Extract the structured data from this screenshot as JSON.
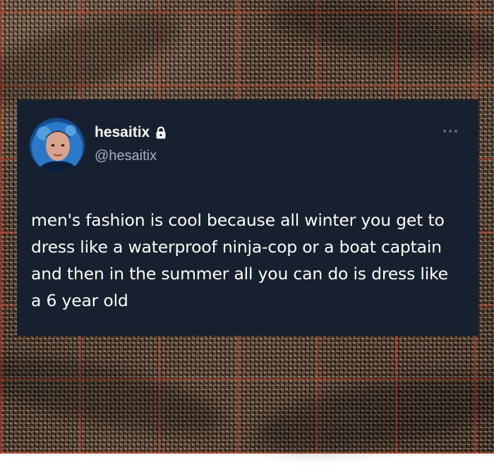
{
  "background": {
    "icon": "plaid-fabric-texture",
    "colors": {
      "base": "#6a4a36",
      "stripe_red": "#c44628",
      "houndstooth_dark": "#1a120d",
      "houndstooth_light": "#e6d7be"
    }
  },
  "post": {
    "author": {
      "display_name": "hesaitix",
      "handle": "@hesaitix",
      "avatar_icon": "profile-photo-icon",
      "locked_icon": "lock-icon"
    },
    "more_icon": "more-options-icon",
    "text": "men's fashion is cool because all winter you get to dress like a waterproof ninja-cop or a boat captain and then in the summer all you can do is dress like a 6 year old",
    "colors": {
      "card_background": "#16202e",
      "text_primary": "#ffffff",
      "text_secondary": "#a7b1bd"
    }
  }
}
